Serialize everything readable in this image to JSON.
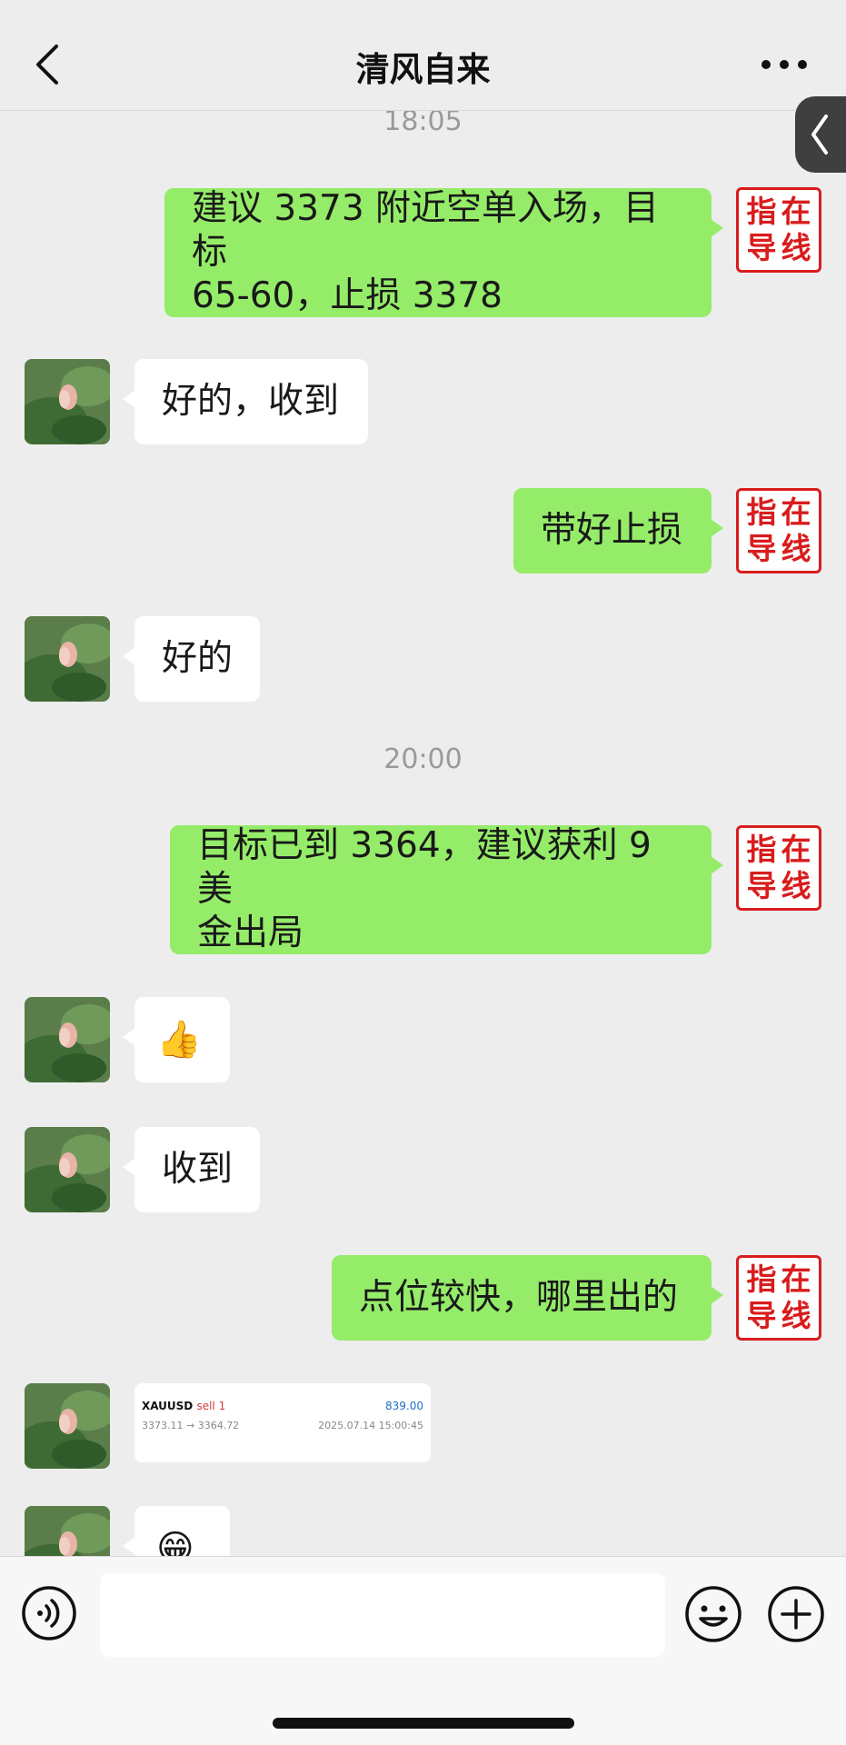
{
  "header": {
    "title": "清风自来"
  },
  "me_avatar_text": [
    "指",
    "在",
    "导",
    "线"
  ],
  "messages": [
    {
      "type": "time",
      "text": "18:05"
    },
    {
      "type": "out",
      "text": "建议 3373 附近空单入场，目标\n65-60，止损 3378"
    },
    {
      "type": "in",
      "text": "好的，收到"
    },
    {
      "type": "out",
      "text": "带好止损"
    },
    {
      "type": "in",
      "text": "好的"
    },
    {
      "type": "time",
      "text": "20:00"
    },
    {
      "type": "out",
      "text": "目标已到 3364，建议获利 9 美\n金出局"
    },
    {
      "type": "in",
      "text": "👍",
      "emoji": "thumbs-up"
    },
    {
      "type": "in",
      "text": "收到"
    },
    {
      "type": "out",
      "text": "点位较快，哪里出的"
    },
    {
      "type": "in",
      "kind": "trade-card"
    },
    {
      "type": "in",
      "text": "😁",
      "emoji": "grinning-face"
    }
  ],
  "trade_card": {
    "symbol": "XAUUSD",
    "side": "sell 1",
    "profit": "839.00",
    "prices": "3373.11 → 3364.72",
    "time": "2025.07.14 15:00:45"
  },
  "colors": {
    "outgoing_bubble": "#95ec69",
    "incoming_bubble": "#ffffff",
    "background": "#ededed",
    "stamp_red": "#d91c1c"
  },
  "icons": {
    "back": "chevron-left-icon",
    "more": "more-dots-icon",
    "side_tab": "chevron-left-icon",
    "voice": "voice-icon",
    "emoji": "emoji-icon",
    "plus": "plus-icon"
  }
}
